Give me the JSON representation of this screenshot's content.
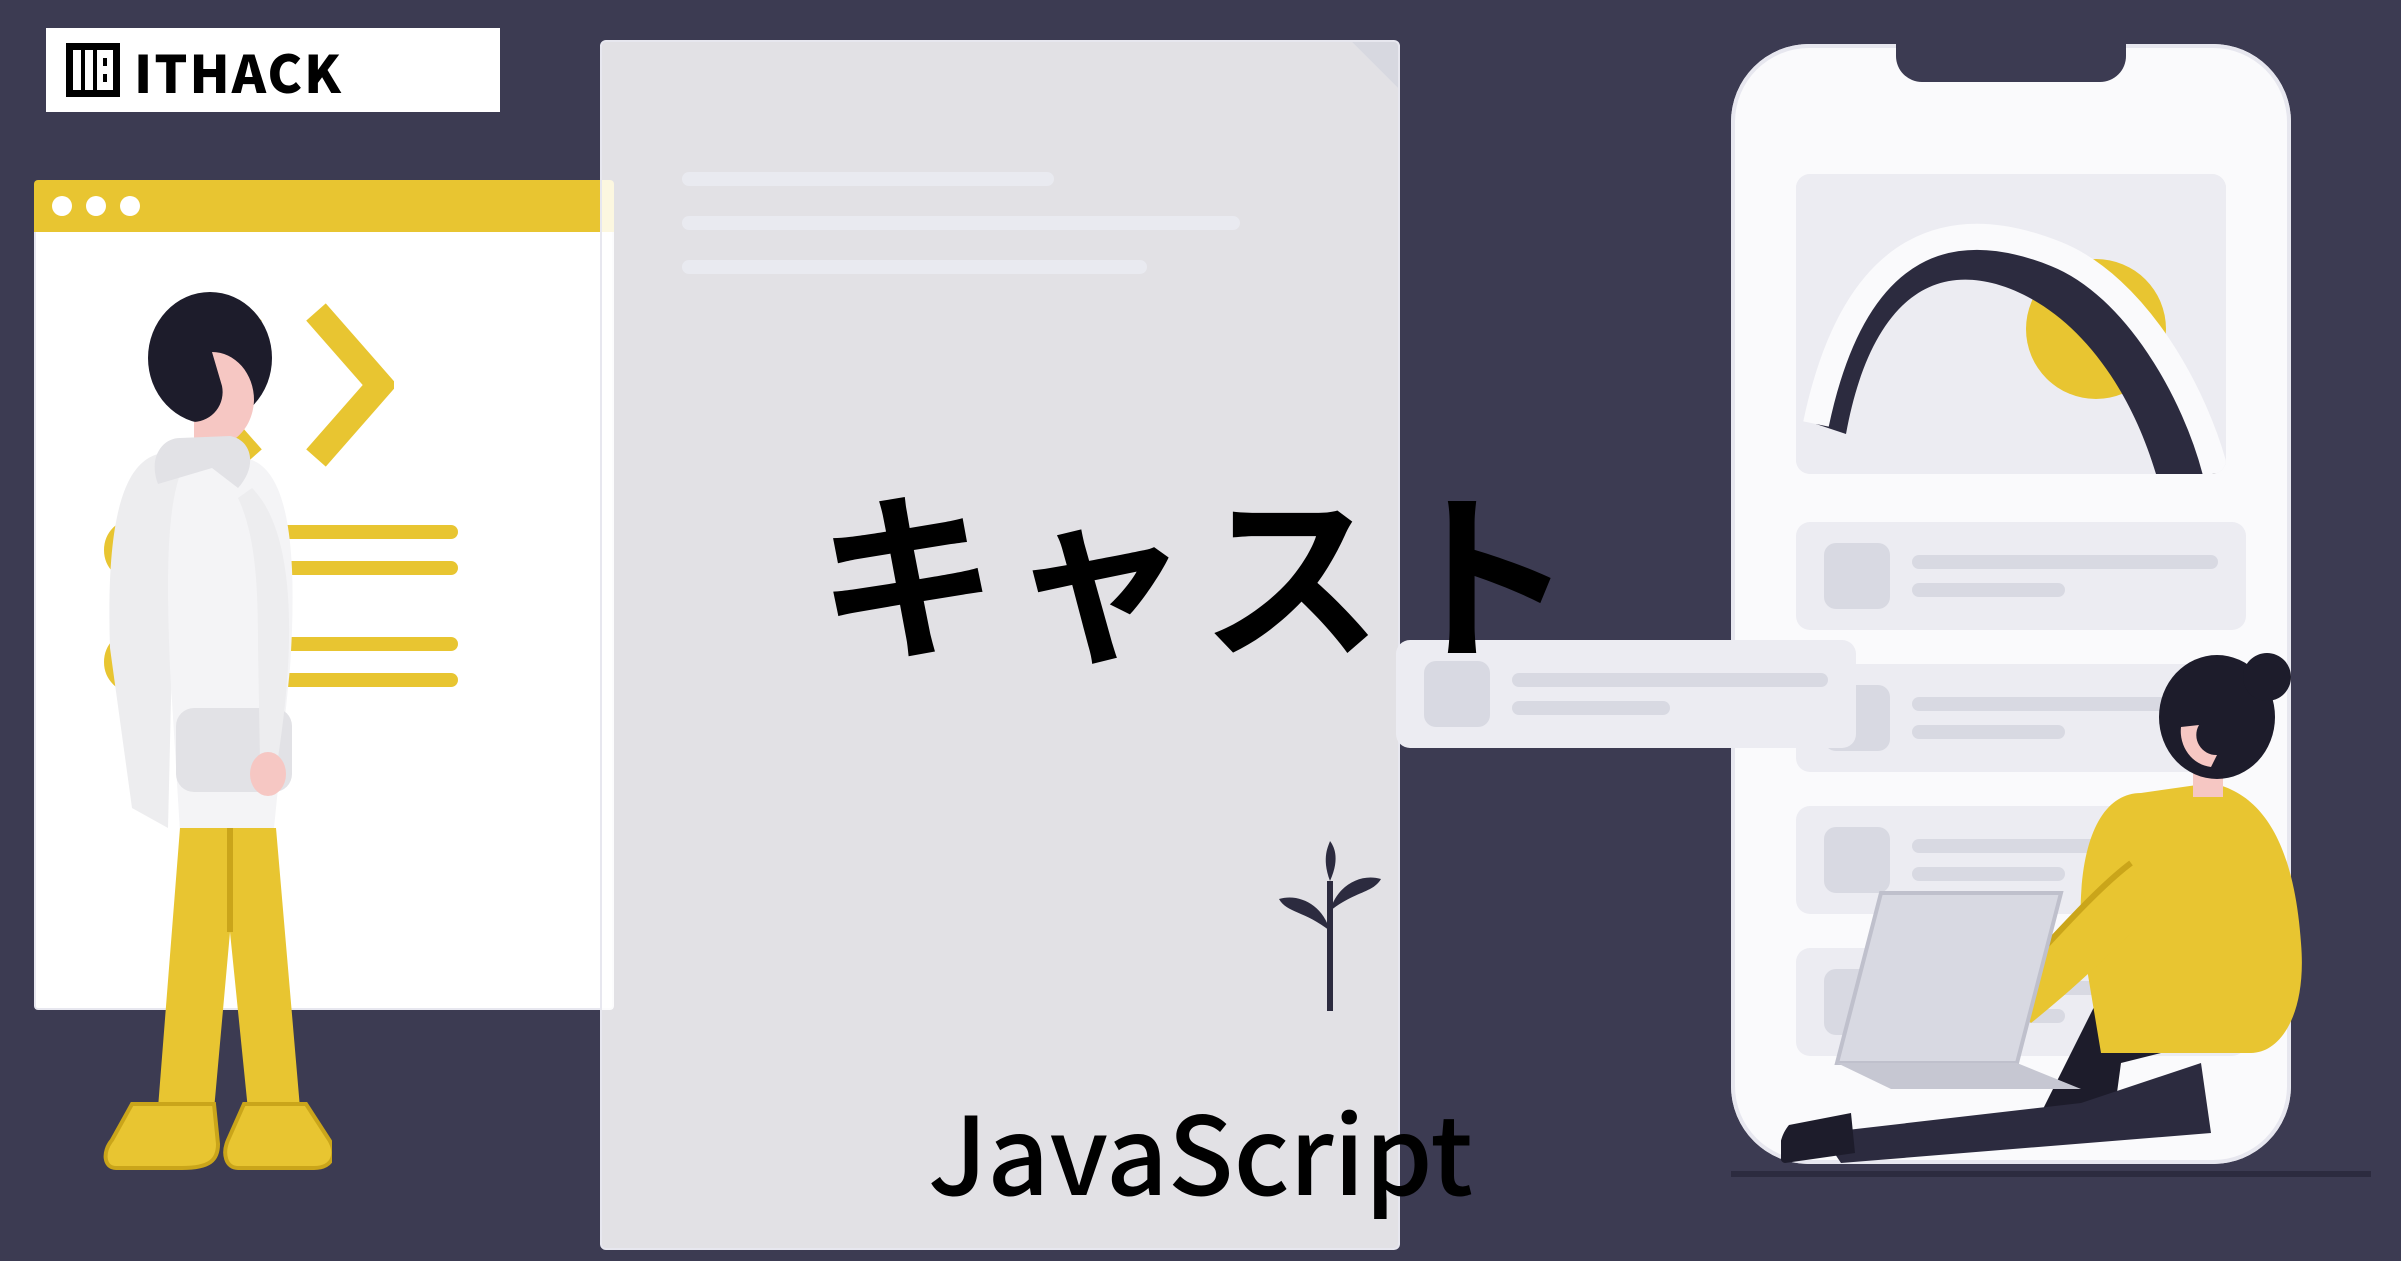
{
  "brand": {
    "name": "ITHACK",
    "logo_icon": "ithack-logo-icon"
  },
  "title": {
    "japanese": "キャスト",
    "english": "JavaScript"
  },
  "colors": {
    "background": "#3c3b52",
    "accent_yellow": "#e8c531",
    "panel": "#ffffff",
    "soft_panel": "#ececf2",
    "text": "#000000"
  },
  "illustration": {
    "browser_dots": 3,
    "code_bracket_icon": "angle-brackets-icon",
    "phone_notch": true,
    "phone_cards": 4,
    "plant_icon": "plant-sprout-icon",
    "person_left": "standing-person-yellow-pants",
    "person_right": "sitting-person-with-laptop"
  }
}
